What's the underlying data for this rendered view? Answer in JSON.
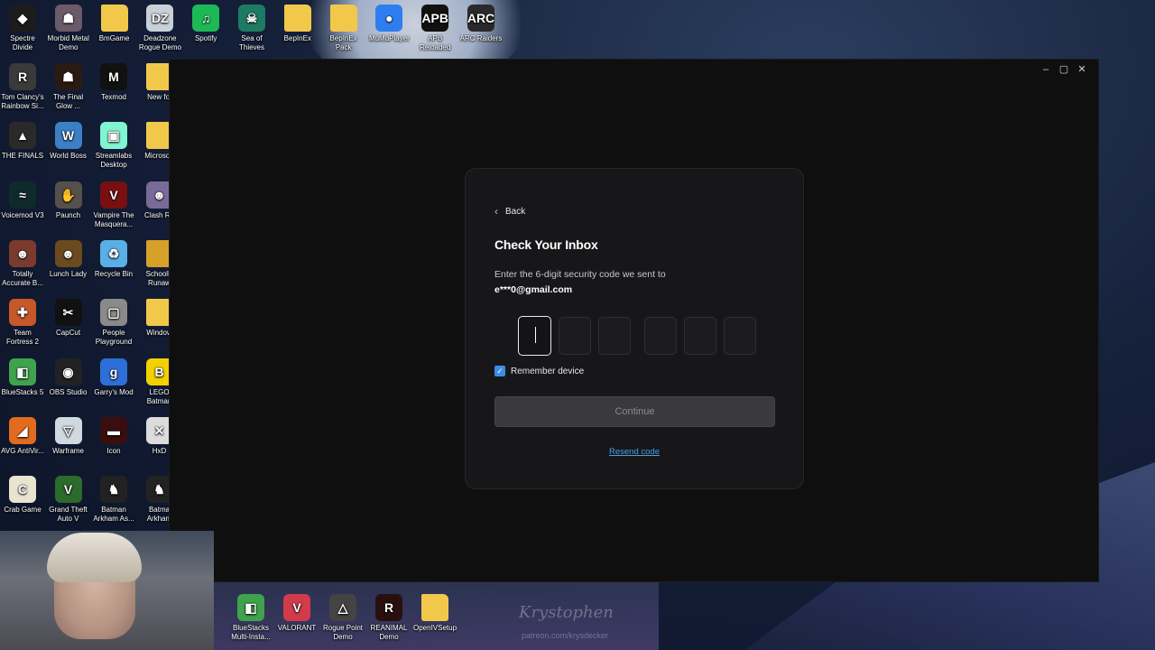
{
  "desktop": {
    "top_row": [
      {
        "label": "Spectre Divide",
        "color": "#1c1c1c",
        "glyph": "◆"
      },
      {
        "label": "Morbid Metal Demo",
        "color": "#6b5a6a",
        "glyph": "☗"
      },
      {
        "label": "BmGame",
        "color": "#f2c84b",
        "glyph": ""
      },
      {
        "label": "Deadzone Rogue Demo",
        "color": "#c8d0d8",
        "glyph": "DZ"
      },
      {
        "label": "Spotify",
        "color": "#1db954",
        "glyph": "♫"
      },
      {
        "label": "Sea of Thieves",
        "color": "#1f7a64",
        "glyph": "☠"
      },
      {
        "label": "BepInEx",
        "color": "#f2c84b",
        "glyph": ""
      },
      {
        "label": "BepInEx Pack",
        "color": "#f2c84b",
        "glyph": ""
      },
      {
        "label": "MuMuPlayer",
        "color": "#2f7ef0",
        "glyph": "●"
      },
      {
        "label": "APB Reloaded",
        "color": "#111111",
        "glyph": "APB"
      },
      {
        "label": "ARC Raiders",
        "color": "#2a2a2a",
        "glyph": "ARC"
      }
    ],
    "col1": [
      {
        "label": "Tom Clancy's Rainbow Si...",
        "color": "#3a3a3a",
        "glyph": "R"
      },
      {
        "label": "THE FINALS",
        "color": "#2a2a2a",
        "glyph": "▲"
      },
      {
        "label": "Voicemod V3",
        "color": "#0e2a2a",
        "glyph": "≈"
      },
      {
        "label": "Totally Accurate B...",
        "color": "#7a3b2e",
        "glyph": "☻"
      },
      {
        "label": "Team Fortress 2",
        "color": "#c7582a",
        "glyph": "✚"
      },
      {
        "label": "BlueStacks 5",
        "color": "#3fa34d",
        "glyph": "◧"
      },
      {
        "label": "AVG AntiVir...",
        "color": "#e26b1f",
        "glyph": "◢"
      },
      {
        "label": "Crab Game",
        "color": "#e9e3d0",
        "glyph": "C"
      }
    ],
    "col2": [
      {
        "label": "The Final Glow ...",
        "color": "#2a1a12",
        "glyph": "☗"
      },
      {
        "label": "World Boss",
        "color": "#3b7fc4",
        "glyph": "W"
      },
      {
        "label": "Paunch",
        "color": "#55504c",
        "glyph": "✋"
      },
      {
        "label": "Lunch Lady",
        "color": "#6b4a1f",
        "glyph": "☻"
      },
      {
        "label": "CapCut",
        "color": "#111111",
        "glyph": "✂"
      },
      {
        "label": "OBS Studio",
        "color": "#222222",
        "glyph": "◉"
      },
      {
        "label": "Warframe",
        "color": "#d0d8e0",
        "glyph": "▽"
      },
      {
        "label": "Grand Theft Auto V",
        "color": "#2b6b2b",
        "glyph": "V"
      }
    ],
    "col3": [
      {
        "label": "Texmod",
        "color": "#111111",
        "glyph": "M"
      },
      {
        "label": "Streamlabs Desktop",
        "color": "#80f5d2",
        "glyph": "▣"
      },
      {
        "label": "Vampire The Masquera...",
        "color": "#7a0f12",
        "glyph": "V"
      },
      {
        "label": "Recycle Bin",
        "color": "#5ab0e6",
        "glyph": "♻"
      },
      {
        "label": "People Playground",
        "color": "#8a8a8a",
        "glyph": "▢"
      },
      {
        "label": "Garry's Mod",
        "color": "#2d6fd6",
        "glyph": "g"
      },
      {
        "label": "Icon",
        "color": "#3a0e0e",
        "glyph": "▬"
      },
      {
        "label": "Batman Arkham As...",
        "color": "#222222",
        "glyph": "♞"
      }
    ],
    "col4": [
      {
        "label": "New fol",
        "color": "#f2c84b",
        "glyph": ""
      },
      {
        "label": "Microsoft",
        "color": "#f2c84b",
        "glyph": ""
      },
      {
        "label": "Clash Ro",
        "color": "#7a6a9a",
        "glyph": "☻"
      },
      {
        "label": "SchoolB Runaw",
        "color": "#d6a02a",
        "glyph": ""
      },
      {
        "label": "Window",
        "color": "#f2c84b",
        "glyph": ""
      },
      {
        "label": "LEGO Batman",
        "color": "#f2d100",
        "glyph": "B"
      },
      {
        "label": "HxD",
        "color": "#dcdcdc",
        "glyph": "✕"
      },
      {
        "label": "Batma Arkham",
        "color": "#222222",
        "glyph": "♞"
      }
    ],
    "bottom_row": [
      {
        "label": "BlueStacks Multi-Insta...",
        "color": "#3fa34d",
        "glyph": "◧"
      },
      {
        "label": "VALORANT",
        "color": "#d23b4b",
        "glyph": "V"
      },
      {
        "label": "Rogue Point Demo",
        "color": "#444444",
        "glyph": "△"
      },
      {
        "label": "REANIMAL Demo",
        "color": "#2a0f0f",
        "glyph": "R"
      },
      {
        "label": "OpenIVSetup",
        "color": "#f2c84b",
        "glyph": ""
      }
    ]
  },
  "window": {
    "controls": {
      "minimize": "–",
      "maximize": "▢",
      "close": "✕"
    }
  },
  "auth": {
    "back_label": "Back",
    "title": "Check Your Inbox",
    "subtitle": "Enter the 6-digit security code we sent to",
    "email": "e***0@gmail.com",
    "code_digits": [
      "",
      "",
      "",
      "",
      "",
      ""
    ],
    "remember_label": "Remember device",
    "remember_checked": true,
    "continue_label": "Continue",
    "resend_label": "Resend code"
  },
  "overlay": {
    "watermark": "Krystophen",
    "watermark_sub": "patreon.com/krysdecker"
  }
}
